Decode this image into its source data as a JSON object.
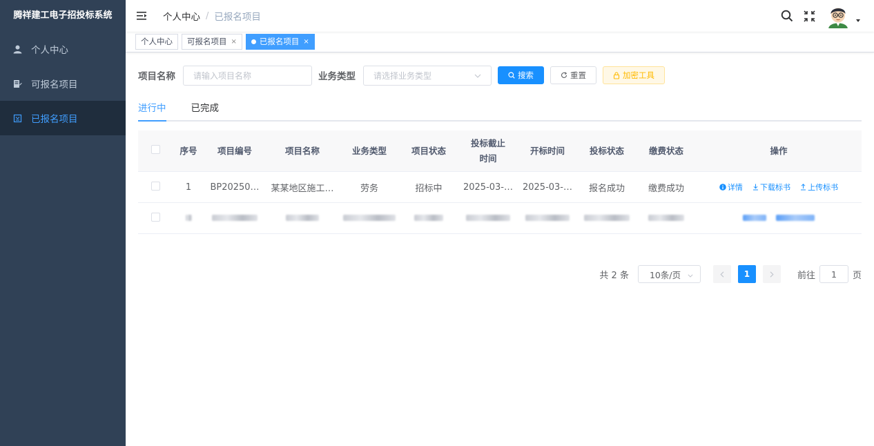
{
  "app": {
    "title": "腾祥建工电子招投标系统"
  },
  "sidebar": {
    "items": [
      {
        "label": "个人中心",
        "icon": "user-icon"
      },
      {
        "label": "可报名项目",
        "icon": "document-edit-icon"
      },
      {
        "label": "已报名项目",
        "icon": "list-box-icon",
        "active": true
      }
    ]
  },
  "header": {
    "breadcrumb": [
      "个人中心",
      "已报名项目"
    ],
    "separator": "/"
  },
  "tags": [
    {
      "label": "个人中心"
    },
    {
      "label": "可报名项目",
      "close": "×"
    },
    {
      "label": "已报名项目",
      "close": "×",
      "active": true
    }
  ],
  "filter": {
    "name_label": "项目名称",
    "name_placeholder": "请输入项目名称",
    "type_label": "业务类型",
    "type_placeholder": "请选择业务类型",
    "search_label": "搜索",
    "reset_label": "重置",
    "encrypt_label": "加密工具"
  },
  "tabs": [
    "进行中",
    "已完成"
  ],
  "table": {
    "columns": [
      "序号",
      "项目编号",
      "项目名称",
      "业务类型",
      "项目状态",
      "投标截止时间",
      "开标时间",
      "投标状态",
      "缴费状态",
      "操作"
    ],
    "rows": [
      {
        "index": "1",
        "code": "BP20250…",
        "name": "某某地区施工…",
        "type": "劳务",
        "status": "招标中",
        "deadline": "2025-03-…",
        "open_time": "2025-03-…",
        "bid_status": "报名成功",
        "pay_status": "缴费成功",
        "actions": [
          "详情",
          "下载标书",
          "上传标书"
        ]
      }
    ]
  },
  "pagination": {
    "total": "共 2 条",
    "page_size": "10条/页",
    "current": "1",
    "goto_label": "前往",
    "goto_value": "1",
    "page_unit": "页"
  },
  "colors": {
    "sidebar_bg": "#304156",
    "primary": "#1890ff",
    "warning": "#ffba00"
  }
}
